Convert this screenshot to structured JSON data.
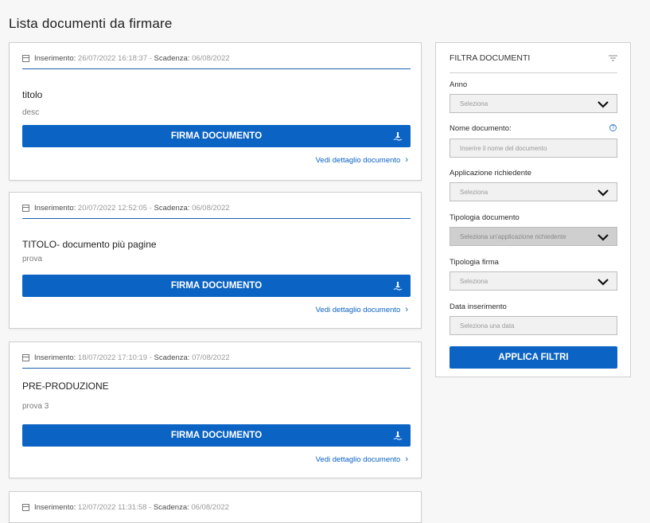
{
  "page": {
    "title": "Lista documenti da firmare"
  },
  "labels": {
    "inserimento": "Inserimento:",
    "scadenza": "Scadenza:",
    "sign_button": "FIRMA DOCUMENTO",
    "detail_link": "Vedi dettaglio documento"
  },
  "documents": [
    {
      "inserimento": "26/07/2022 16:18:37",
      "scadenza": "06/08/2022",
      "title": "titolo",
      "desc": "desc"
    },
    {
      "inserimento": "20/07/2022 12:52:05",
      "scadenza": "06/08/2022",
      "title": "TITOLO- documento più pagine",
      "desc": "prova"
    },
    {
      "inserimento": "18/07/2022 17:10:19",
      "scadenza": "07/08/2022",
      "title": "PRE-PRODUZIONE",
      "desc": "prova 3"
    },
    {
      "inserimento": "12/07/2022 11:31:58",
      "scadenza": "06/08/2022"
    }
  ],
  "filters": {
    "heading": "FILTRA DOCUMENTI",
    "anno": {
      "label": "Anno",
      "placeholder": "Seleziona"
    },
    "nome": {
      "label": "Nome documento:",
      "placeholder": "Inserire il nome del documento"
    },
    "applicazione": {
      "label": "Applicazione richiedente",
      "placeholder": "Seleziona"
    },
    "tipologia_documento": {
      "label": "Tipologia documento",
      "placeholder": "Seleziona un'applicazione richiedente"
    },
    "tipologia_firma": {
      "label": "Tipologia firma",
      "placeholder": "Seleziona"
    },
    "data": {
      "label": "Data inserimento",
      "placeholder": "Seleziona una data"
    },
    "apply_button": "APPLICA FILTRI"
  },
  "colors": {
    "primary": "#0b63c4",
    "divider": "#1d5fad"
  }
}
